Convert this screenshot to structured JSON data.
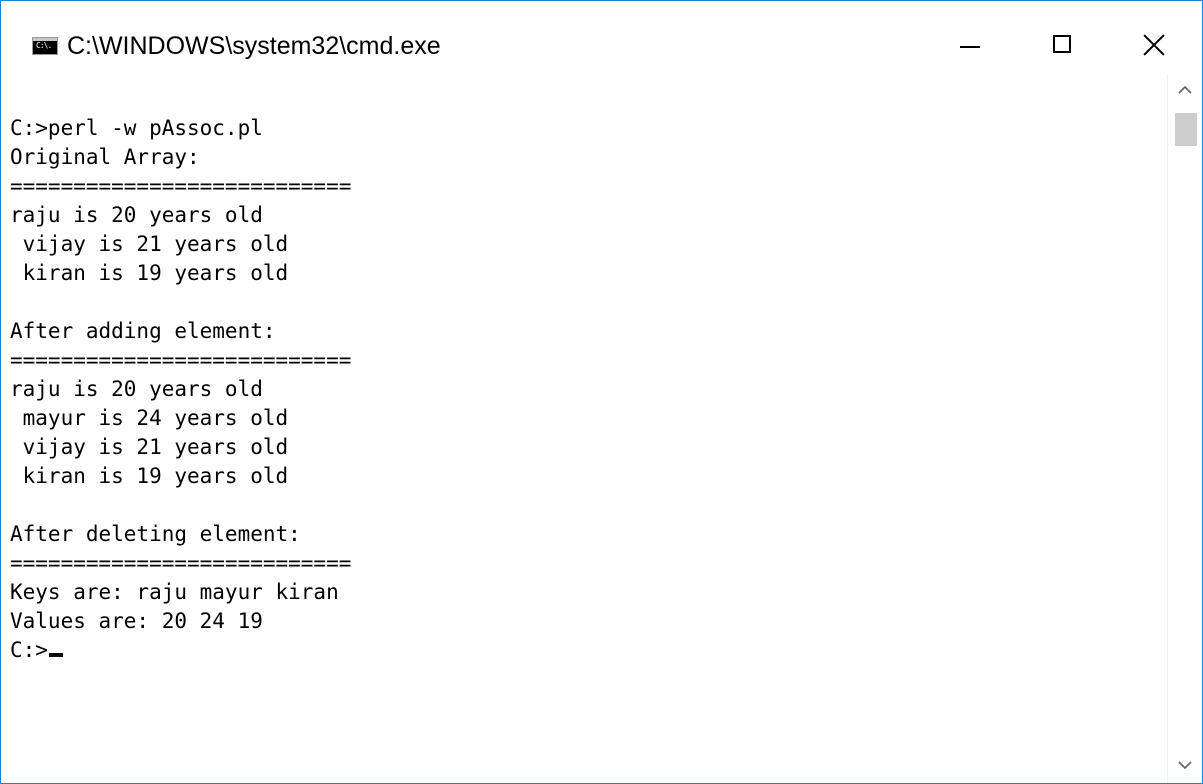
{
  "window": {
    "title": "C:\\WINDOWS\\system32\\cmd.exe",
    "icon_label": "C:\\.",
    "minimize_icon": "minimize-icon",
    "maximize_icon": "maximize-icon",
    "close_icon": "close-icon"
  },
  "console": {
    "lines": [
      "C:>perl -w pAssoc.pl",
      "Original Array:",
      "===========================",
      "raju is 20 years old",
      " vijay is 21 years old",
      " kiran is 19 years old",
      "",
      "After adding element:",
      "===========================",
      "raju is 20 years old",
      " mayur is 24 years old",
      " vijay is 21 years old",
      " kiran is 19 years old",
      "",
      "After deleting element:",
      "===========================",
      "Keys are: raju mayur kiran",
      "Values are: 20 24 19"
    ],
    "prompt": "C:>"
  },
  "scrollbar": {
    "up_icon": "chevron-up-icon",
    "down_icon": "chevron-down-icon"
  }
}
